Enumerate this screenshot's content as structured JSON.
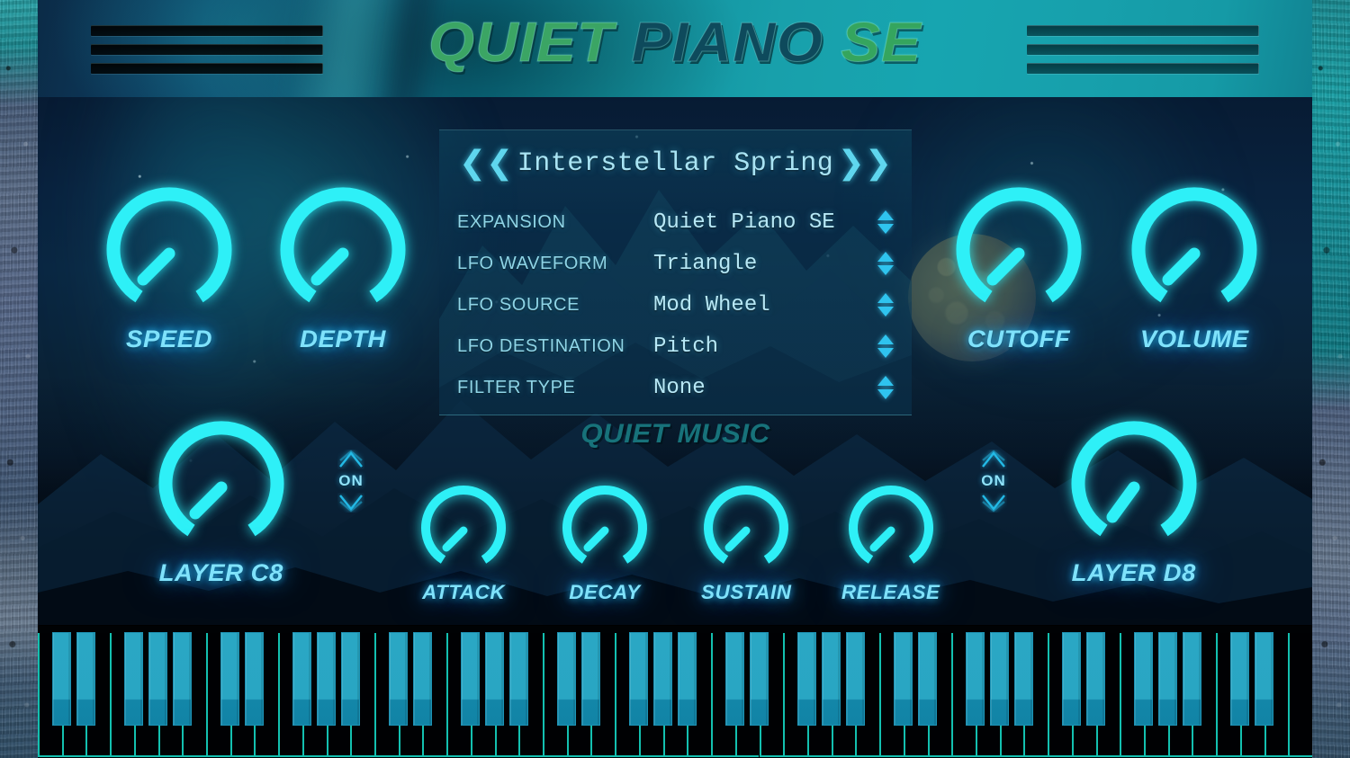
{
  "header": {
    "title_parts": [
      "QUIET",
      "PIANO",
      "SE"
    ],
    "vent_left_name": "vent-grille-left",
    "vent_right_name": "vent-grille-right"
  },
  "preset": {
    "prev_label": "❮❮",
    "next_label": "❯❯",
    "name": "Interstellar Spring"
  },
  "params": [
    {
      "label": "EXPANSION",
      "value": "Quiet Piano SE"
    },
    {
      "label": "LFO WAVEFORM",
      "value": "Triangle"
    },
    {
      "label": "LFO SOURCE",
      "value": "Mod Wheel"
    },
    {
      "label": "LFO DESTINATION",
      "value": "Pitch"
    },
    {
      "label": "FILTER TYPE",
      "value": "None"
    }
  ],
  "brand": "QUIET MUSIC",
  "knobs": {
    "speed": {
      "label": "SPEED"
    },
    "depth": {
      "label": "DEPTH"
    },
    "cutoff": {
      "label": "CUTOFF"
    },
    "volume": {
      "label": "VOLUME"
    },
    "layer_c8": {
      "label": "LAYER C8"
    },
    "layer_d8": {
      "label": "LAYER D8"
    },
    "attack": {
      "label": "ATTACK"
    },
    "decay": {
      "label": "DECAY"
    },
    "sustain": {
      "label": "SUSTAIN"
    },
    "release": {
      "label": "RELEASE"
    }
  },
  "toggles": {
    "layer_c8_state": "ON",
    "layer_d8_state": "ON"
  },
  "colors": {
    "knob_cyan": "#2ef0f7",
    "label_cyan": "#7fe2fb",
    "panel_text": "#b7e8f6",
    "panel_label": "#8ed4e6",
    "brand_teal": "#17727a",
    "title_green": "#3ba564",
    "title_dark": "#0e4a5c",
    "key_cyan": "#2aa7c4",
    "key_outline": "#13c0b0"
  }
}
